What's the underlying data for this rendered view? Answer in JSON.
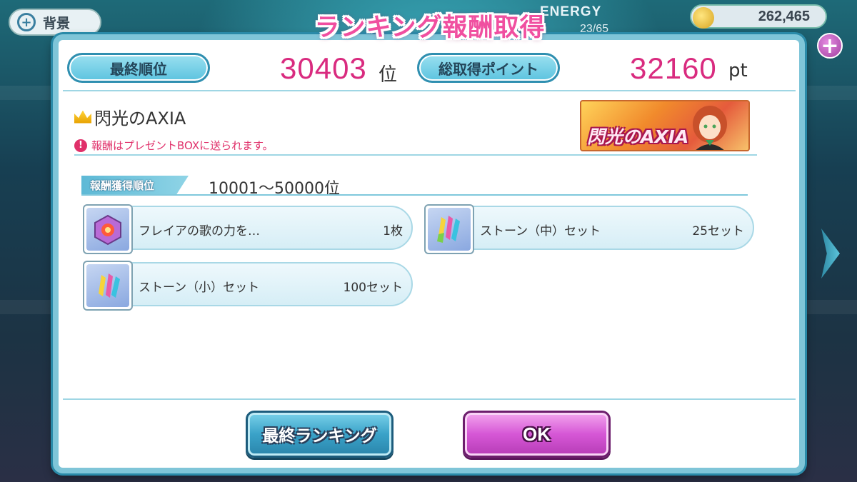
{
  "background": {
    "back_button_label": "背景",
    "energy_label": "ENERGY",
    "energy_value": "23/65",
    "coin_value": "262,465"
  },
  "dialog": {
    "title": "ランキング報酬取得",
    "final_rank_label": "最終順位",
    "final_rank_value": "30403",
    "final_rank_unit": "位",
    "total_points_label": "総取得ポイント",
    "total_points_value": "32160",
    "total_points_unit": "pt",
    "event_name": "閃光のAXIA",
    "notice": "報酬はプレゼントBOXに送られます。",
    "banner_text": "閃光のAXIA",
    "reward_rank_tag": "報酬獲得順位",
    "reward_rank_range": "10001〜50000位",
    "rewards": [
      {
        "name": "フレイアの歌の力を…",
        "qty": "1枚",
        "icon": "song-power-cube-icon"
      },
      {
        "name": "ストーン（中）セット",
        "qty": "25セット",
        "icon": "stone-medium-set-icon"
      },
      {
        "name": "ストーン（小）セット",
        "qty": "100セット",
        "icon": "stone-small-set-icon"
      }
    ],
    "final_ranking_button": "最終ランキング",
    "ok_button": "OK"
  }
}
